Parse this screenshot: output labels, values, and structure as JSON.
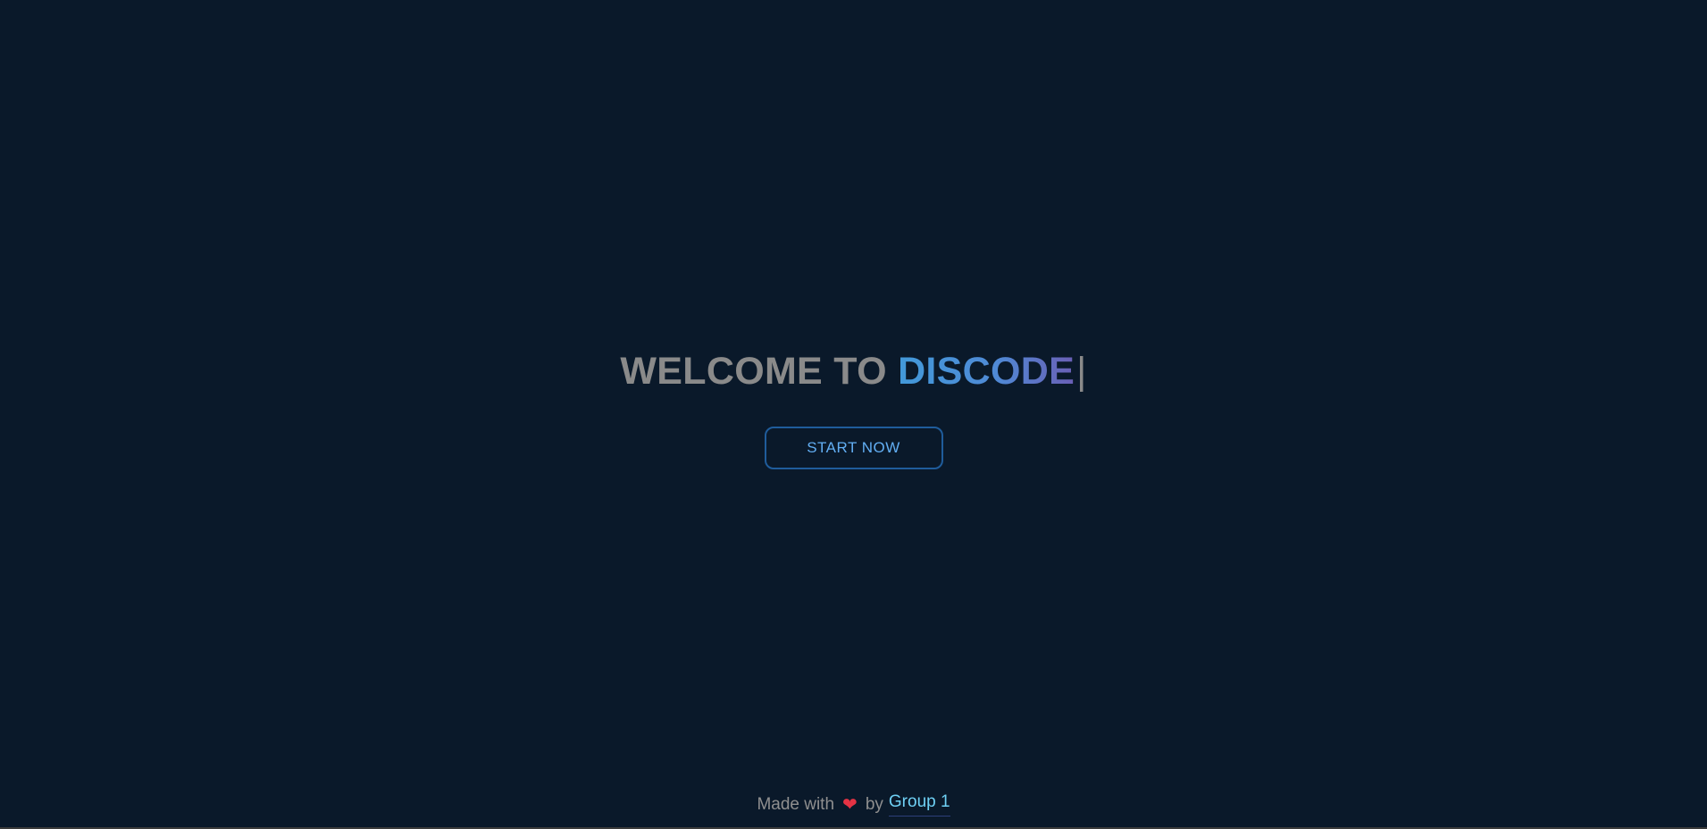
{
  "hero": {
    "headline_prefix": "WELCOME TO ",
    "headline_brand": "DISCODE",
    "headline_cursor": "|",
    "start_button_label": "START NOW"
  },
  "footer": {
    "made_with_text": "Made with",
    "heart_symbol": "❤",
    "by_text": "by",
    "author_link": "Group 1"
  },
  "colors": {
    "background": "#0a192a",
    "headline_text": "#8a8a8a",
    "brand_gradient_start": "#4299d9",
    "brand_gradient_end": "#6a5fb5",
    "button_border": "#1f5c9b",
    "button_text": "#62aef3",
    "heart": "#e53344",
    "author_link": "#6fd1f5"
  },
  "icons": {
    "heart": "heart-icon"
  }
}
